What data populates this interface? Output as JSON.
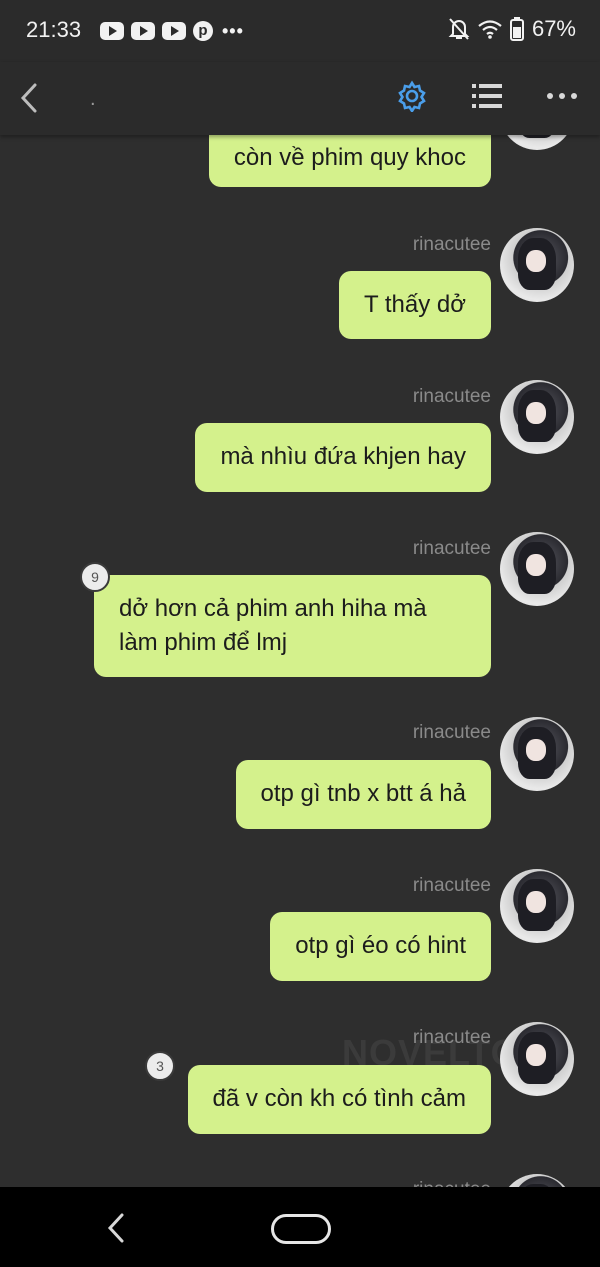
{
  "status_bar": {
    "time": "21:33",
    "notification_icons": [
      "youtube-icon",
      "youtube-icon",
      "youtube-icon",
      "pinterest-icon"
    ],
    "battery": "67%"
  },
  "app_bar": {
    "title": ".",
    "accent_color": "#4a9eea"
  },
  "chat": {
    "bubble_color": "#d4f18c",
    "messages": [
      {
        "sender": "",
        "text": "còn về phim quy khoc",
        "badge": ""
      },
      {
        "sender": "rinacutee",
        "text": "T thấy dở",
        "badge": ""
      },
      {
        "sender": "rinacutee",
        "text": "mà nhìu đứa khjen hay",
        "badge": ""
      },
      {
        "sender": "rinacutee",
        "text": "dở hơn cả phim anh hiha mà làm phim để lmj",
        "badge": "9"
      },
      {
        "sender": "rinacutee",
        "text": "otp gì tnb x btt á hả",
        "badge": ""
      },
      {
        "sender": "rinacutee",
        "text": "otp gì éo có hint",
        "badge": ""
      },
      {
        "sender": "rinacutee",
        "text": "đã v còn kh có tình cảm",
        "badge": "3"
      },
      {
        "sender": "rinacutee",
        "text": "",
        "badge": ""
      }
    ],
    "watermark": "NOVELTO"
  }
}
